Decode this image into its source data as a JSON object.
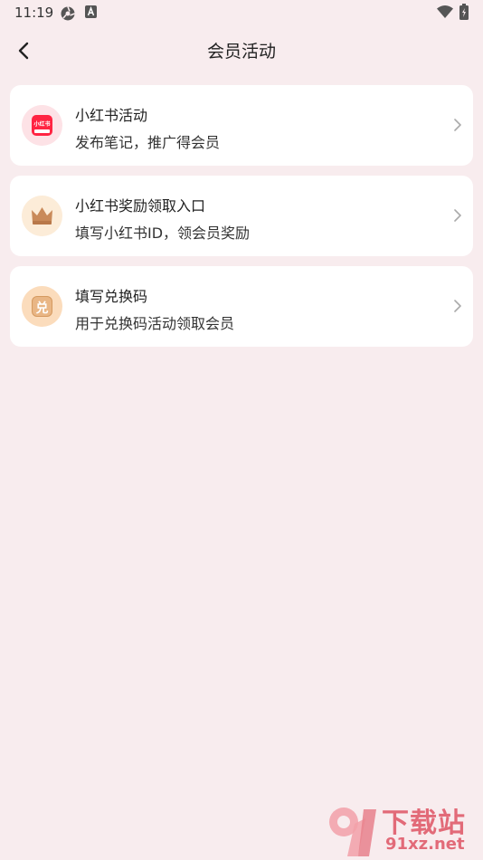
{
  "status_bar": {
    "time": "11:19"
  },
  "header": {
    "title": "会员活动"
  },
  "cards": [
    {
      "title": "小红书活动",
      "subtitle": "发布笔记，推广得会员",
      "icon": "xiaohongshu-logo",
      "badge_text": "小红书"
    },
    {
      "title": "小红书奖励领取入口",
      "subtitle": "填写小红书ID，领会员奖励",
      "icon": "crown-icon"
    },
    {
      "title": "填写兑换码",
      "subtitle": "用于兑换码活动领取会员",
      "icon": "redeem-icon",
      "icon_text": "兑"
    }
  ],
  "watermark": {
    "brand": "下载站",
    "domain": "91xz.net"
  },
  "colors": {
    "background": "#f8ecee",
    "card": "#ffffff",
    "xhs_red": "#ff2442",
    "crown": "#c98a5a",
    "redeem": "#e9b685"
  }
}
